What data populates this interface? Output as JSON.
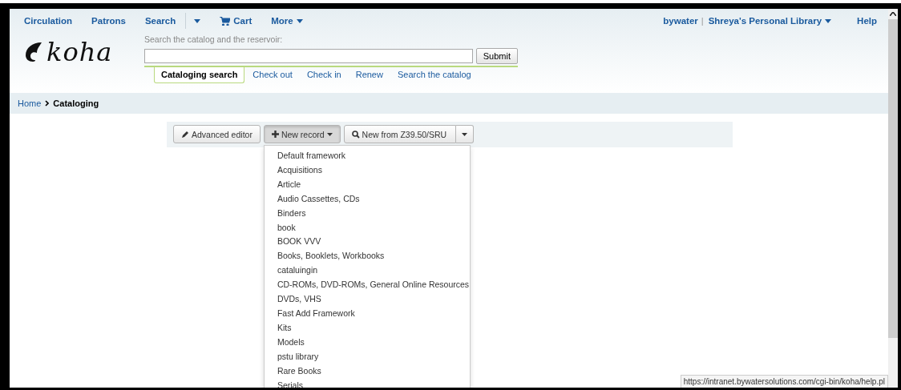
{
  "nav": {
    "left": [
      {
        "label": "Circulation",
        "kind": "link"
      },
      {
        "label": "Patrons",
        "kind": "link"
      },
      {
        "label": "Search",
        "kind": "link"
      },
      {
        "kind": "caret"
      },
      {
        "label": "Cart",
        "kind": "cart"
      },
      {
        "label": "More",
        "kind": "menu"
      }
    ],
    "user": "bywater",
    "separator": "|",
    "library": "Shreya's Personal Library",
    "help": "Help"
  },
  "logo": "koha",
  "search": {
    "label": "Search the catalog and the reservoir:",
    "submit": "Submit",
    "tabs": [
      {
        "label": "Cataloging search",
        "selected": true
      },
      {
        "label": "Check out",
        "selected": false
      },
      {
        "label": "Check in",
        "selected": false
      },
      {
        "label": "Renew",
        "selected": false
      },
      {
        "label": "Search the catalog",
        "selected": false
      }
    ]
  },
  "breadcrumb": [
    {
      "label": "Home"
    },
    {
      "label": "Cataloging"
    }
  ],
  "toolbar": {
    "advanced_editor": "Advanced editor",
    "new_record": "New record",
    "new_from": "New from Z39.50/SRU",
    "new_record_open": true
  },
  "frameworks": [
    "Default framework",
    "Acquisitions",
    "Article",
    "Audio Cassettes, CDs",
    "Binders",
    "book",
    "BOOK VVV",
    "Books, Booklets, Workbooks",
    "cataluingin",
    "CD-ROMs, DVD-ROMs, General Online Resources",
    "DVDs, VHS",
    "Fast Add Framework",
    "Kits",
    "Models",
    "pstu library",
    "Rare Books",
    "Serials"
  ],
  "status_url": "https://intranet.bywatersolutions.com/cgi-bin/koha/help.pl"
}
